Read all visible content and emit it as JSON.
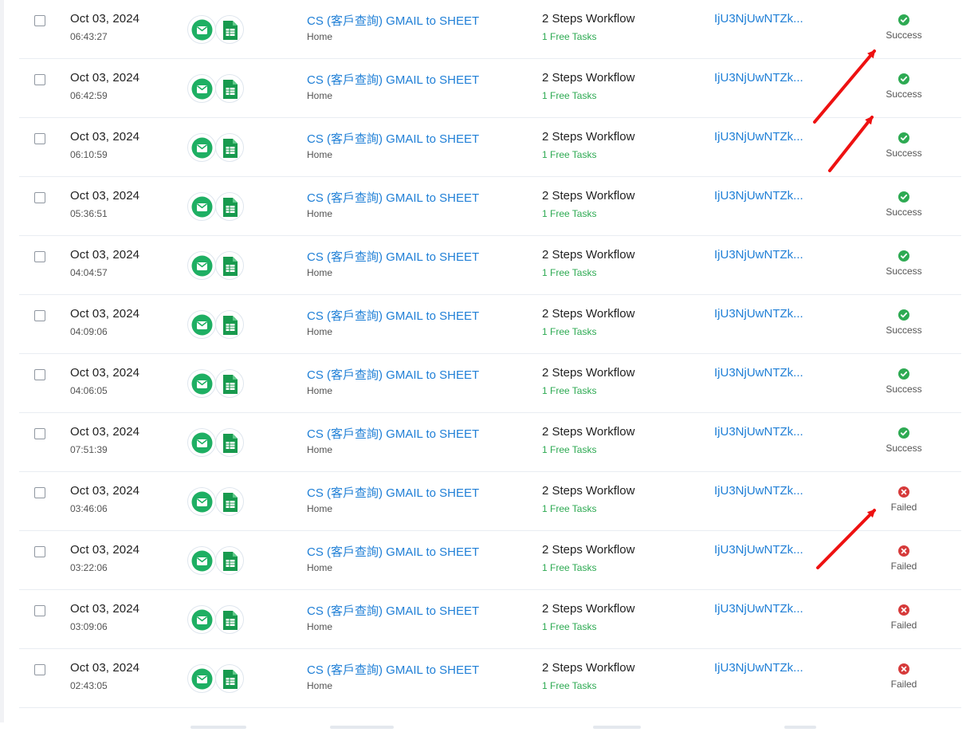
{
  "icons": {
    "gmail": "gmail-icon",
    "sheets": "google-sheets-icon",
    "success": "check-circle-icon",
    "failed": "x-circle-icon"
  },
  "colors": {
    "link": "#1f7fd6",
    "success": "#2eaa53",
    "failed": "#d63a3a",
    "gmail": "#1eaf63",
    "sheets": "#189a4e",
    "annotation": "#ee1111"
  },
  "rows": [
    {
      "date": "Oct 03, 2024",
      "time": "06:43:27",
      "title": "CS (客戶查詢) GMAIL to SHEET",
      "folder": "Home",
      "steps": "2 Steps Workflow",
      "tasks": "1 Free Tasks",
      "run_id": "IjU3NjUwNTZk...",
      "status": "Success"
    },
    {
      "date": "Oct 03, 2024",
      "time": "06:42:59",
      "title": "CS (客戶查詢) GMAIL to SHEET",
      "folder": "Home",
      "steps": "2 Steps Workflow",
      "tasks": "1 Free Tasks",
      "run_id": "IjU3NjUwNTZk...",
      "status": "Success"
    },
    {
      "date": "Oct 03, 2024",
      "time": "06:10:59",
      "title": "CS (客戶查詢) GMAIL to SHEET",
      "folder": "Home",
      "steps": "2 Steps Workflow",
      "tasks": "1 Free Tasks",
      "run_id": "IjU3NjUwNTZk...",
      "status": "Success"
    },
    {
      "date": "Oct 03, 2024",
      "time": "05:36:51",
      "title": "CS (客戶查詢) GMAIL to SHEET",
      "folder": "Home",
      "steps": "2 Steps Workflow",
      "tasks": "1 Free Tasks",
      "run_id": "IjU3NjUwNTZk...",
      "status": "Success"
    },
    {
      "date": "Oct 03, 2024",
      "time": "04:04:57",
      "title": "CS (客戶查詢) GMAIL to SHEET",
      "folder": "Home",
      "steps": "2 Steps Workflow",
      "tasks": "1 Free Tasks",
      "run_id": "IjU3NjUwNTZk...",
      "status": "Success"
    },
    {
      "date": "Oct 03, 2024",
      "time": "04:09:06",
      "title": "CS (客戶查詢) GMAIL to SHEET",
      "folder": "Home",
      "steps": "2 Steps Workflow",
      "tasks": "1 Free Tasks",
      "run_id": "IjU3NjUwNTZk...",
      "status": "Success"
    },
    {
      "date": "Oct 03, 2024",
      "time": "04:06:05",
      "title": "CS (客戶查詢) GMAIL to SHEET",
      "folder": "Home",
      "steps": "2 Steps Workflow",
      "tasks": "1 Free Tasks",
      "run_id": "IjU3NjUwNTZk...",
      "status": "Success"
    },
    {
      "date": "Oct 03, 2024",
      "time": "07:51:39",
      "title": "CS (客戶查詢) GMAIL to SHEET",
      "folder": "Home",
      "steps": "2 Steps Workflow",
      "tasks": "1 Free Tasks",
      "run_id": "IjU3NjUwNTZk...",
      "status": "Success"
    },
    {
      "date": "Oct 03, 2024",
      "time": "03:46:06",
      "title": "CS (客戶查詢) GMAIL to SHEET",
      "folder": "Home",
      "steps": "2 Steps Workflow",
      "tasks": "1 Free Tasks",
      "run_id": "IjU3NjUwNTZk...",
      "status": "Failed"
    },
    {
      "date": "Oct 03, 2024",
      "time": "03:22:06",
      "title": "CS (客戶查詢) GMAIL to SHEET",
      "folder": "Home",
      "steps": "2 Steps Workflow",
      "tasks": "1 Free Tasks",
      "run_id": "IjU3NjUwNTZk...",
      "status": "Failed"
    },
    {
      "date": "Oct 03, 2024",
      "time": "03:09:06",
      "title": "CS (客戶查詢) GMAIL to SHEET",
      "folder": "Home",
      "steps": "2 Steps Workflow",
      "tasks": "1 Free Tasks",
      "run_id": "IjU3NjUwNTZk...",
      "status": "Failed"
    },
    {
      "date": "Oct 03, 2024",
      "time": "02:43:05",
      "title": "CS (客戶查詢) GMAIL to SHEET",
      "folder": "Home",
      "steps": "2 Steps Workflow",
      "tasks": "1 Free Tasks",
      "run_id": "IjU3NjUwNTZk...",
      "status": "Failed"
    }
  ]
}
